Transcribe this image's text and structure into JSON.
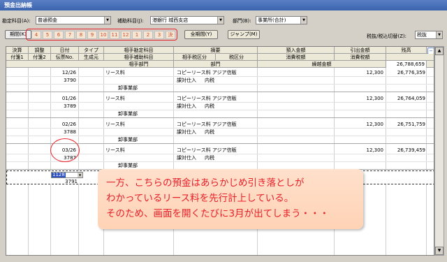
{
  "window_title": "預金出納帳",
  "filters": {
    "account_label": "勘定科目(A):",
    "account_value": "普通預金",
    "sub_account_label": "補助科目(J):",
    "sub_account_value": "港銀行 城西支店",
    "dept_label": "部門(B):",
    "dept_value": "事業所(合計)"
  },
  "period": {
    "label": "期間(K)",
    "months": [
      "4",
      "5",
      "6",
      "7",
      "8",
      "9",
      "10",
      "11",
      "12",
      "1",
      "2",
      "3",
      "決"
    ],
    "all_period_button": "全期間(Y)",
    "jump_button": "ジャンプ(M)",
    "tax_label": "税抜/税込切替(Z):",
    "tax_value": "税抜"
  },
  "headers": {
    "row1": [
      "決算",
      "調整",
      "日付",
      "タイプ",
      "相手勘定科目",
      "摘要",
      "預入金額",
      "引出金額",
      "残高"
    ],
    "row2": [
      "付箋1",
      "付箋2",
      "伝票No.",
      "生成元",
      "相手補助科目",
      "相手税区分",
      "税区分",
      "消費税額",
      "消費税額"
    ],
    "row3": [
      "相手部門",
      "部門",
      "繰越金額",
      "26,788,659"
    ]
  },
  "entries": [
    {
      "date": "12/26",
      "slip": "3790",
      "partner": "リース料",
      "desc": "コピーリース料 アジア信販",
      "tax_kind": "課対仕入",
      "tax": "内税",
      "dept": "卸事業部",
      "withdraw": "12,300",
      "balance": "26,776,359"
    },
    {
      "date": "01/26",
      "slip": "3789",
      "partner": "リース料",
      "desc": "コピーリース料 アジア信販",
      "tax_kind": "課対仕入",
      "tax": "内税",
      "dept": "卸事業部",
      "withdraw": "12,300",
      "balance": "26,764,059"
    },
    {
      "date": "02/26",
      "slip": "3788",
      "partner": "リース料",
      "desc": "コピーリース料 アジア信販",
      "tax_kind": "課対仕入",
      "tax": "内税",
      "dept": "卸事業部",
      "withdraw": "12,300",
      "balance": "26,751,759"
    },
    {
      "date": "03/26",
      "slip": "3787",
      "partner": "リース料",
      "desc": "コピーリース料 アジア信販",
      "tax_kind": "課対仕入",
      "tax": "内税",
      "dept": "卸事業部",
      "withdraw": "12,300",
      "balance": "26,739,459"
    }
  ],
  "new_row": {
    "date_value": "1128",
    "slip": "3791"
  },
  "callout": {
    "line1": "一方、こちらの預金はあらかじめ引き落としが",
    "line2": "わかっているリース料を先行計上している。",
    "line3": "そのため、画面を開くたびに3月が出てしまう・・・"
  },
  "colors": {
    "annotation_red": "#e8202a",
    "period_tab_text": "#d24b2c",
    "title_blue": "#3b64b0"
  }
}
